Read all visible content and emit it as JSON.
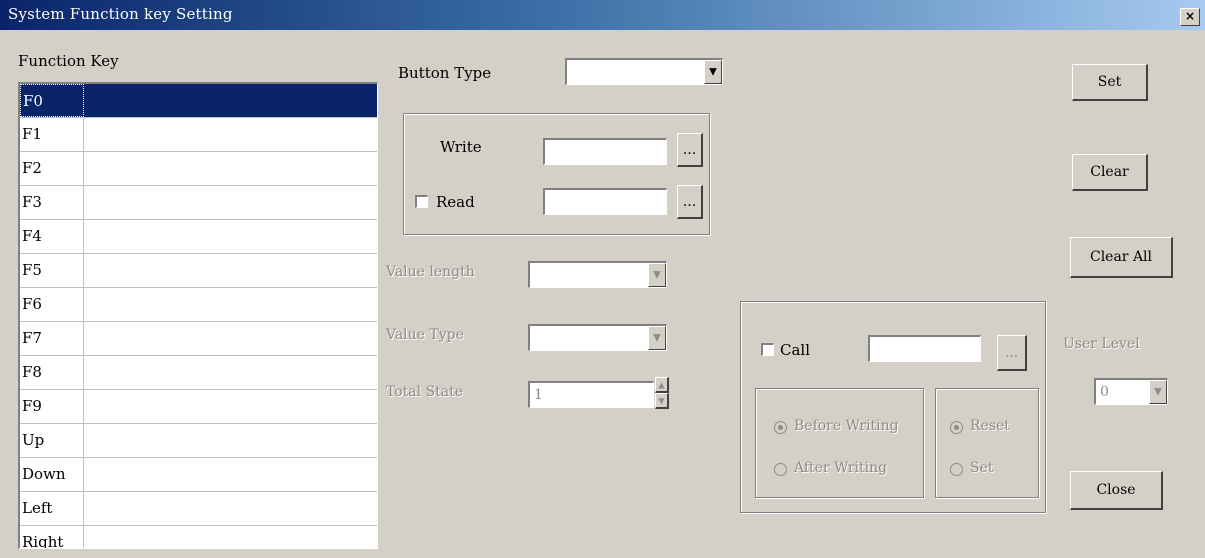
{
  "window": {
    "title": "System Function key Setting",
    "close_glyph": "×"
  },
  "function_key": {
    "label": "Function Key",
    "items": [
      "F0",
      "F1",
      "F2",
      "F3",
      "F4",
      "F5",
      "F6",
      "F7",
      "F8",
      "F9",
      "Up",
      "Down",
      "Left",
      "Right"
    ],
    "selected": "F0"
  },
  "button_type": {
    "label": "Button Type",
    "value": ""
  },
  "write": {
    "label": "Write",
    "value": "",
    "browse": "..."
  },
  "read": {
    "label": "Read",
    "value": "",
    "browse": "...",
    "checked": false
  },
  "value_length": {
    "label": "Value length",
    "value": ""
  },
  "value_type": {
    "label": "Value Type",
    "value": ""
  },
  "total_state": {
    "label": "Total State",
    "value": "1"
  },
  "call": {
    "label": "Call",
    "value": "",
    "browse": "...",
    "checked": false
  },
  "timing": {
    "before": "Before Writing",
    "after": "After Writing",
    "selected": "before"
  },
  "action": {
    "reset": "Reset",
    "set": "Set",
    "selected": "reset"
  },
  "user_level": {
    "label": "User Level",
    "value": "0"
  },
  "buttons": {
    "set": "Set",
    "clear": "Clear",
    "clear_all": "Clear All",
    "close": "Close"
  },
  "colors": {
    "face": "#d4d0c8",
    "selection": "#0a246a",
    "title_start": "#0a246a",
    "title_end": "#a6caf0",
    "disabled": "#8e8c88"
  },
  "icons": {
    "dropdown": "triangle-down",
    "spin_up": "triangle-up",
    "spin_down": "triangle-down"
  }
}
